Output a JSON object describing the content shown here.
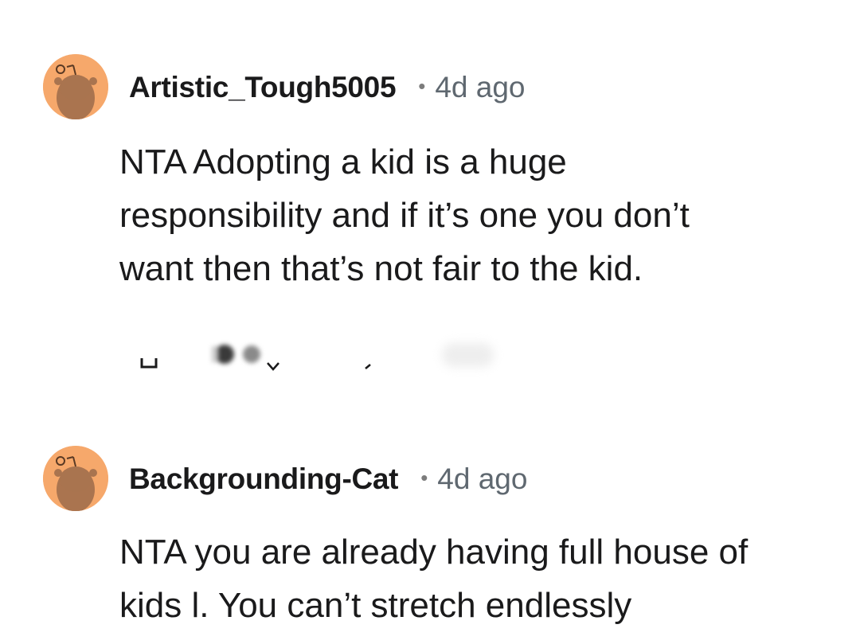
{
  "comments": [
    {
      "username": "Artistic_Tough5005",
      "separator": "•",
      "time": "4d ago",
      "lines": [
        "NTA Adopting a kid is a huge",
        "responsibility and if it’s one you don’t",
        "want then that’s not fair to the kid."
      ],
      "avatar_icon": "reddit-snoo-avatar-icon"
    },
    {
      "username": "Backgrounding-Cat",
      "separator": "•",
      "time": "4d ago",
      "lines": [
        "NTA you are already having full house of",
        "kids l. You can’t stretch endlessly"
      ],
      "avatar_icon": "reddit-snoo-avatar-icon"
    }
  ],
  "actions": {
    "reply_icon": "reply-icon",
    "award_icon": "award-icon",
    "vote_down_icon": "chevron-down-icon",
    "more_icon": "more-icon"
  },
  "colors": {
    "avatar_bg": "#f6a86b",
    "text": "#1a1a1b",
    "muted": "#5f6870"
  }
}
